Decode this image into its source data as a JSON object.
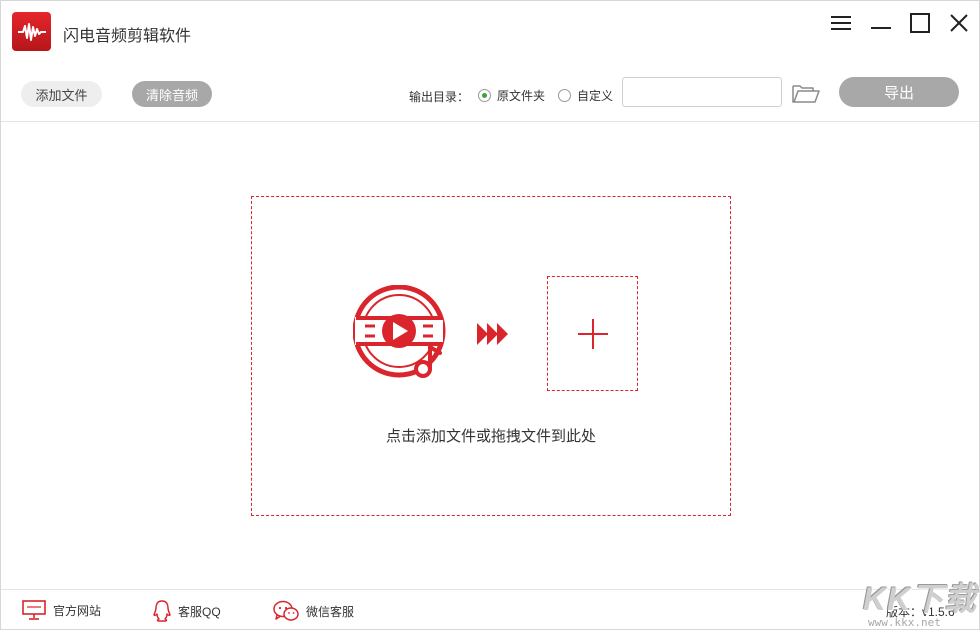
{
  "app": {
    "title": "闪电音频剪辑软件",
    "accent_color": "#d9252b"
  },
  "window_controls": {
    "menu_icon": "menu-icon",
    "minimize_icon": "minimize-icon",
    "maximize_icon": "maximize-icon",
    "close_icon": "close-icon"
  },
  "toolbar": {
    "add_file_label": "添加文件",
    "clear_audio_label": "清除音频",
    "output_dir_label": "输出目录：",
    "radio_original_label": "原文件夹",
    "radio_custom_label": "自定义",
    "selected_output": "原文件夹",
    "dir_input_value": "",
    "dir_input_placeholder": "",
    "folder_icon": "folder-open-icon",
    "export_label": "导出"
  },
  "dropzone": {
    "hint": "点击添加文件或拖拽文件到此处",
    "icons": [
      "music-video-icon",
      "fast-forward-icon",
      "plus-icon"
    ]
  },
  "footer": {
    "website_label": "官方网站",
    "qq_label": "客服QQ",
    "wechat_label": "微信客服",
    "version": "版本：v1.5.6"
  },
  "watermark": {
    "logo_text": "KK下载",
    "url": "www.kkx.net"
  }
}
